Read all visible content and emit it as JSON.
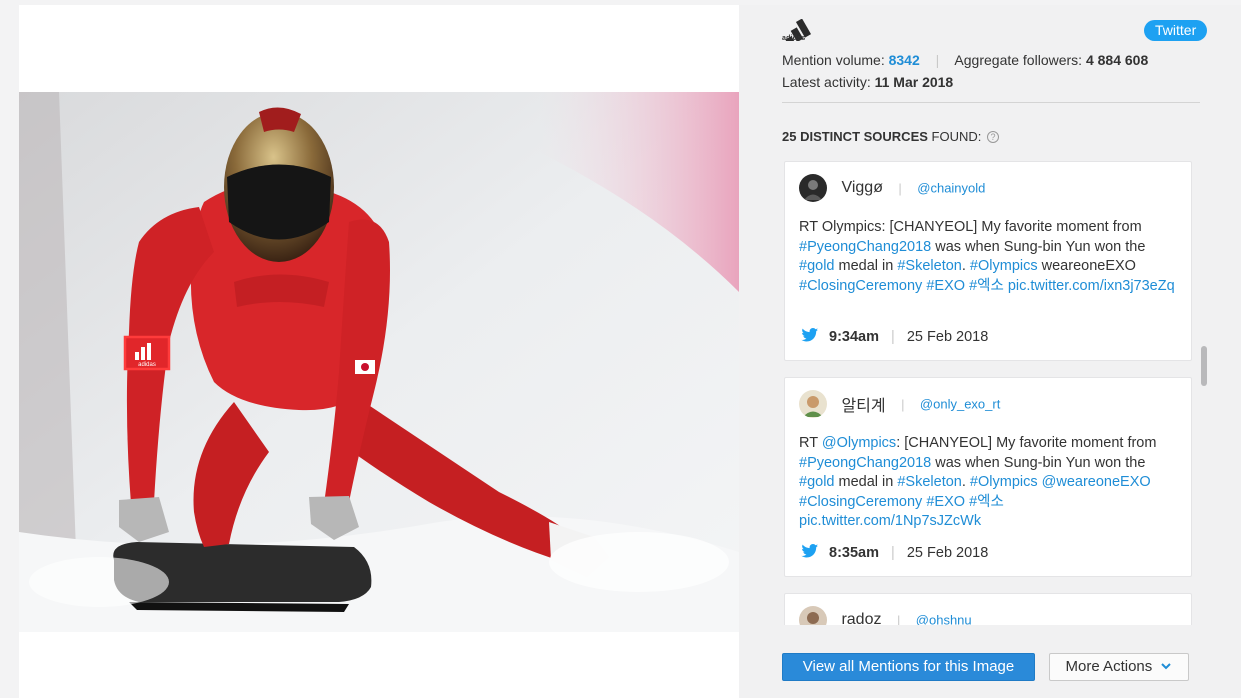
{
  "colors": {
    "accent": "#1f8dd6",
    "twitter": "#1da1f2",
    "primary_button": "#2a8ad9"
  },
  "image": {
    "subject": "skeleton athlete on sled",
    "highlighted_logo_icon": "adidas-logo-icon"
  },
  "brand": {
    "logo_icon": "adidas-logo-icon",
    "logo_text": "adidas"
  },
  "network_badge": "Twitter",
  "stats": {
    "mention_volume_label": "Mention volume:",
    "mention_volume_value": "8342",
    "followers_label": "Aggregate followers:",
    "followers_value": "4 884 608",
    "latest_label": "Latest activity:",
    "latest_value": "11 Mar 2018"
  },
  "sources": {
    "count_text": "25 DISTINCT SOURCES",
    "found_text": "FOUND:",
    "help_icon": "?"
  },
  "mentions": [
    {
      "author": "Viggø",
      "handle": "@chainyold",
      "text_parts": [
        "RT Olympics: [CHANYEOL] My favorite moment from ",
        "#PyeongChang2018",
        " was when Sung-bin Yun won the ",
        "#gold",
        " medal in ",
        "#Skeleton",
        ". ",
        "#Olympics",
        " weareoneEXO ",
        "#ClosingCeremony",
        " ",
        "#EXO",
        " ",
        "#엑소",
        " ",
        "pic.twitter.com/ixn3j73eZq"
      ],
      "time": "9:34am",
      "date": "25 Feb 2018"
    },
    {
      "author": "알티계",
      "handle": "@only_exo_rt",
      "text_parts": [
        "RT ",
        "@Olympics",
        ": [CHANYEOL] My favorite moment from ",
        "#PyeongChang2018",
        " was when Sung-bin Yun won the ",
        "#gold",
        " medal in ",
        "#Skeleton",
        ". ",
        "#Olympics",
        " ",
        "@weareoneEXO",
        " ",
        "#ClosingCeremony",
        " ",
        "#EXO",
        " ",
        "#엑소",
        " ",
        "pic.twitter.com/1Np7sJZcWk"
      ],
      "time": "8:35am",
      "date": "25 Feb 2018"
    },
    {
      "author": "radoz",
      "handle": "@ohshnu"
    }
  ],
  "actions": {
    "view_all": "View all Mentions for this Image",
    "more_actions": "More Actions"
  }
}
